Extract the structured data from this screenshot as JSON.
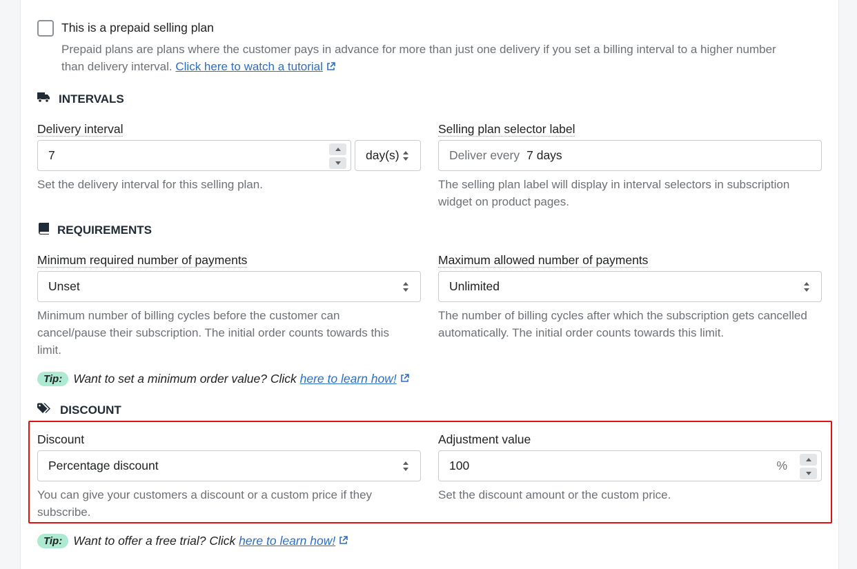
{
  "prepaid": {
    "checkbox_label": "This is a prepaid selling plan",
    "checked": false,
    "help_line1": "Prepaid plans are plans where the customer pays in advance for more than just one delivery if you set a billing interval to a higher number",
    "help_line2": "than delivery interval.",
    "tutorial_link": "Click here to watch a tutorial"
  },
  "intervals": {
    "title": "INTERVALS",
    "icon": "truck-icon",
    "delivery_interval": {
      "label": "Delivery interval",
      "value": "7",
      "unit": "day(s)",
      "help": "Set the delivery interval for this selling plan."
    },
    "selector_label": {
      "label": "Selling plan selector label",
      "prefix": "Deliver every",
      "value": "7 days",
      "help_line1": "The selling plan label will display in interval selectors in subscription",
      "help_line2": "widget on product pages."
    }
  },
  "requirements": {
    "title": "REQUIREMENTS",
    "icon": "book-icon",
    "min_payments": {
      "label": "Minimum required number of payments",
      "value": "Unset",
      "help_line1": "Minimum number of billing cycles before the customer can",
      "help_line2": "cancel/pause their subscription. The initial order counts towards this",
      "help_line3": "limit."
    },
    "max_payments": {
      "label": "Maximum allowed number of payments",
      "value": "Unlimited",
      "help_line1": "The number of billing cycles after which the subscription gets cancelled",
      "help_line2": "automatically. The initial order counts towards this limit."
    },
    "tip": {
      "badge": "Tip:",
      "text": "Want to set a minimum order value? Click",
      "link": "here to learn how!"
    }
  },
  "discount": {
    "title": "DISCOUNT",
    "icon": "tags-icon",
    "type": {
      "label": "Discount",
      "value": "Percentage discount",
      "help_line1": "You can give your customers a discount or a custom price if they",
      "help_line2": "subscribe."
    },
    "adjustment": {
      "label": "Adjustment value",
      "value": "100",
      "suffix": "%",
      "help": "Set the discount amount or the custom price."
    },
    "tip": {
      "badge": "Tip:",
      "text": "Want to offer a free trial? Click",
      "link": "here to learn how!"
    }
  },
  "colors": {
    "highlight": "#e01111",
    "link": "#2c6ecb",
    "tip_badge": "#aee9d1"
  }
}
